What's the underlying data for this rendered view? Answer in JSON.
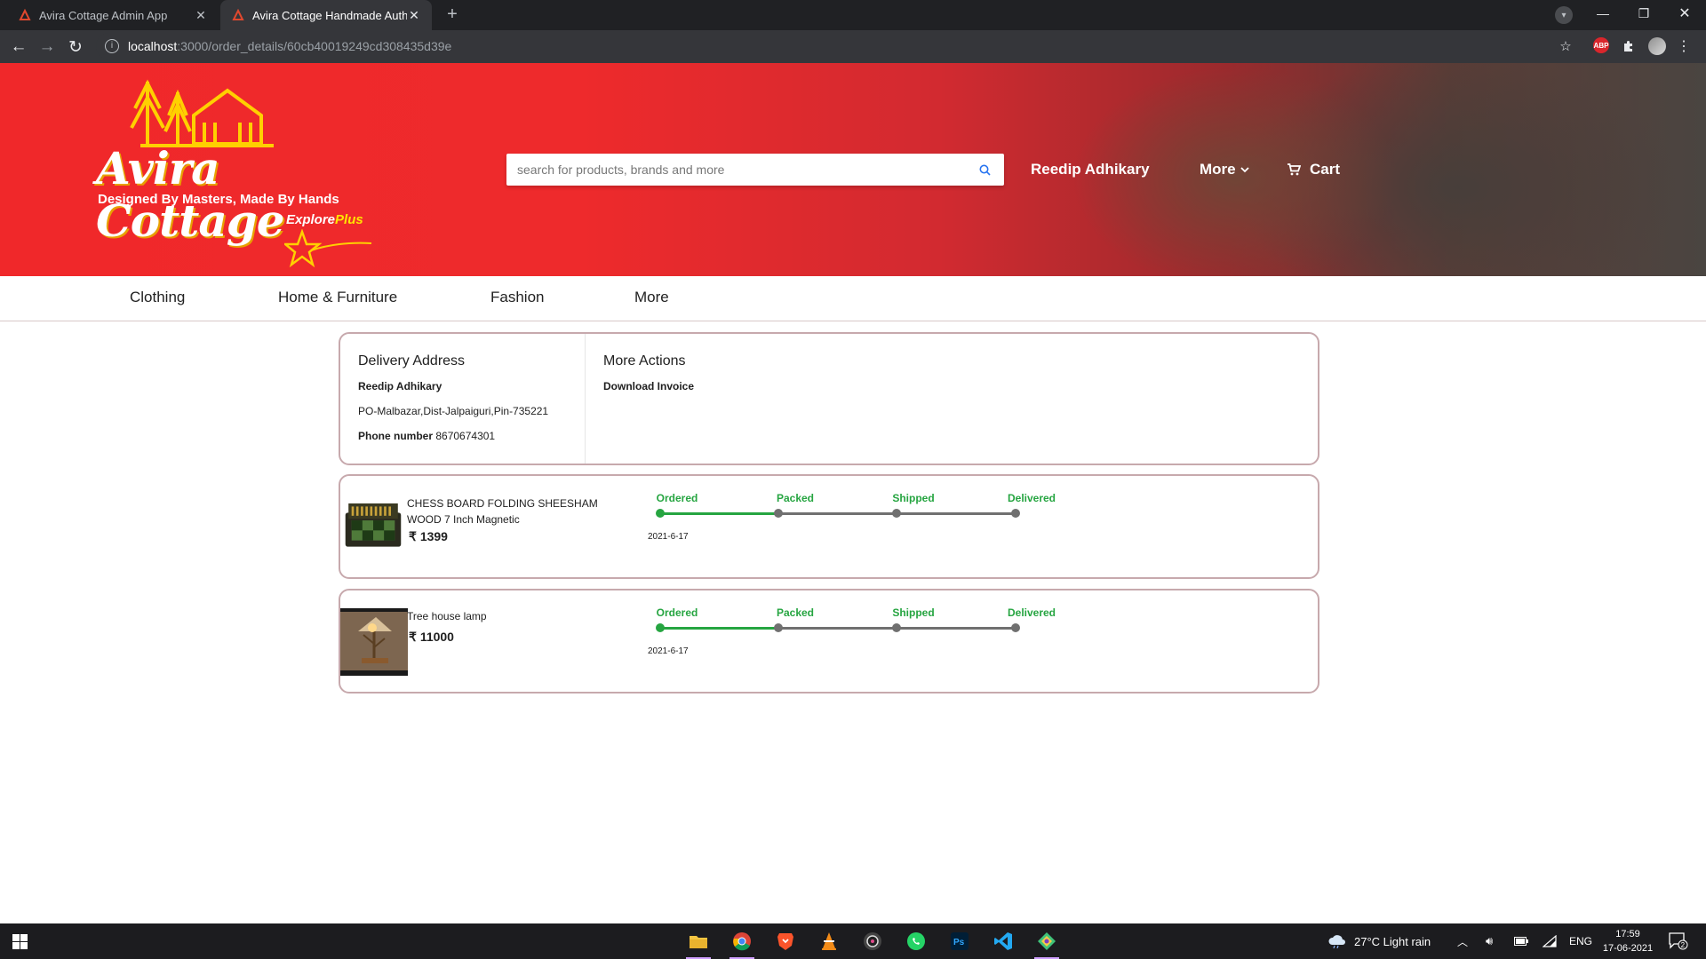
{
  "browser": {
    "tabs": [
      {
        "title": "Avira Cottage Admin App",
        "active": false
      },
      {
        "title": "Avira Cottage Handmade Authen",
        "active": true
      }
    ],
    "url_host": "localhost",
    "url_path": ":3000/order_details/60cb40019249cd308435d39e"
  },
  "header": {
    "logo_title": "Avira Cottage",
    "logo_tagline": "Designed By Masters, Made By Hands",
    "explore": "Explore",
    "explore_plus": "Plus",
    "search_placeholder": "search for products, brands and more",
    "user_name": "Reedip Adhikary",
    "more_label": "More",
    "cart_label": "Cart",
    "accent": "#f0282a"
  },
  "categories": [
    "Clothing",
    "Home & Furniture",
    "Fashion",
    "More"
  ],
  "delivery": {
    "title": "Delivery Address",
    "name": "Reedip Adhikary",
    "address": "PO-Malbazar,Dist-Jalpaiguri,Pin-735221",
    "phone_label": "Phone number",
    "phone": "8670674301"
  },
  "actions": {
    "title": "More Actions",
    "download": "Download Invoice"
  },
  "order_steps": [
    "Ordered",
    "Packed",
    "Shipped",
    "Delivered"
  ],
  "items": [
    {
      "name": "CHESS BOARD FOLDING SHEESHAM WOOD 7 Inch Magnetic",
      "price": "1399",
      "currency": "₹",
      "date": "2021-6-17",
      "current_step": 1
    },
    {
      "name": "Tree house lamp",
      "price": "11000",
      "currency": "₹",
      "date": "2021-6-17",
      "current_step": 1
    }
  ],
  "status_colors": {
    "done": "#26a541",
    "pending": "#707070"
  },
  "taskbar": {
    "weather": "27°C  Light rain",
    "lang": "ENG",
    "time": "17:59",
    "date": "17-06-2021",
    "notifications": "2"
  }
}
